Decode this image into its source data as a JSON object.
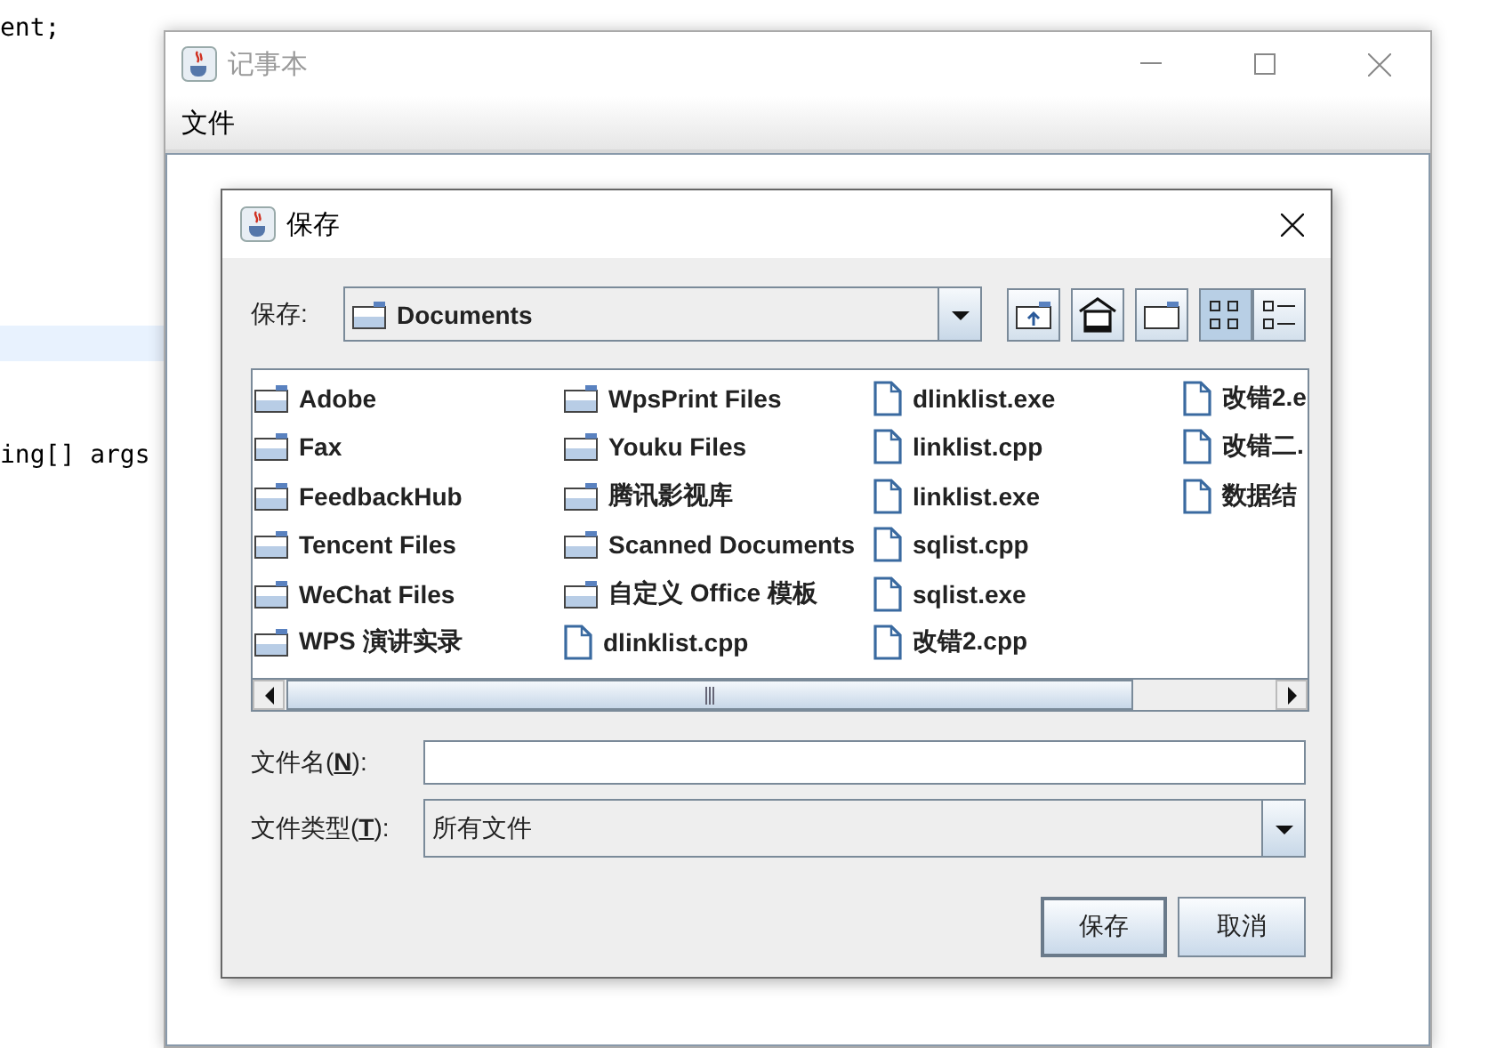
{
  "editor": {
    "lines": [
      {
        "text": "ent;",
        "highlighted": false
      },
      {
        "highlighted": true
      },
      {
        "text": "ing[] args",
        "highlighted": false
      }
    ]
  },
  "notepad": {
    "title": "记事本",
    "active": false,
    "menu": [
      "文件"
    ]
  },
  "dialog": {
    "title": "保存",
    "look_in": {
      "label": "保存:",
      "value": "Documents"
    },
    "toolbar": [
      {
        "kind": "up",
        "selected": false
      },
      {
        "kind": "home",
        "selected": false
      },
      {
        "kind": "new-folder",
        "selected": false
      },
      {
        "kind": "list",
        "selected": true
      },
      {
        "kind": "details",
        "selected": false
      }
    ],
    "columns": [
      [
        {
          "name": "Adobe",
          "kind": "folder"
        },
        {
          "name": "Fax",
          "kind": "folder"
        },
        {
          "name": "FeedbackHub",
          "kind": "folder"
        },
        {
          "name": "Tencent Files",
          "kind": "folder"
        },
        {
          "name": "WeChat Files",
          "kind": "folder"
        },
        {
          "name": "WPS 演讲实录",
          "kind": "folder"
        }
      ],
      [
        {
          "name": "WpsPrint Files",
          "kind": "folder"
        },
        {
          "name": "Youku Files",
          "kind": "folder"
        },
        {
          "name": "腾讯影视库",
          "kind": "folder"
        },
        {
          "name": "Scanned Documents",
          "kind": "folder"
        },
        {
          "name": "自定义 Office 模板",
          "kind": "folder"
        },
        {
          "name": "dlinklist.cpp",
          "kind": "file"
        }
      ],
      [
        {
          "name": "dlinklist.exe",
          "kind": "file"
        },
        {
          "name": "linklist.cpp",
          "kind": "file"
        },
        {
          "name": "linklist.exe",
          "kind": "file"
        },
        {
          "name": "sqlist.cpp",
          "kind": "file"
        },
        {
          "name": "sqlist.exe",
          "kind": "file"
        },
        {
          "name": "改错2.cpp",
          "kind": "file"
        }
      ],
      [
        {
          "name": "改错2.e",
          "kind": "file"
        },
        {
          "name": "改错二.",
          "kind": "file"
        },
        {
          "name": "数据结",
          "kind": "file"
        }
      ]
    ],
    "file_name": {
      "label": "文件名(",
      "mnemonic": "N",
      "suffix": "):"
    },
    "file_type": {
      "label": "文件类型(",
      "mnemonic": "T",
      "suffix": "):",
      "value": "所有文件"
    },
    "buttons": [
      {
        "label": "保存",
        "default": true
      },
      {
        "label": "取消",
        "default": false
      }
    ]
  }
}
